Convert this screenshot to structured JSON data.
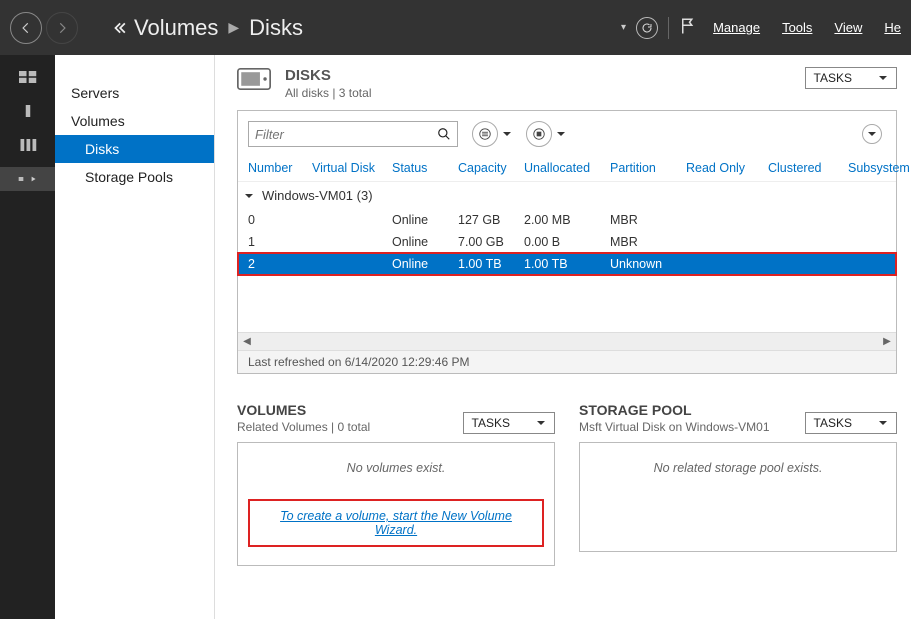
{
  "titlebar": {
    "breadcrumb": [
      "Volumes",
      "Disks"
    ],
    "menu": [
      "Manage",
      "Tools",
      "View",
      "He"
    ]
  },
  "navtree": {
    "items": [
      {
        "label": "Servers",
        "selected": false,
        "child": false
      },
      {
        "label": "Volumes",
        "selected": false,
        "child": false
      },
      {
        "label": "Disks",
        "selected": true,
        "child": true
      },
      {
        "label": "Storage Pools",
        "selected": false,
        "child": true
      }
    ]
  },
  "disks": {
    "title": "DISKS",
    "subtitle": "All disks | 3 total",
    "tasks_label": "TASKS",
    "filter_placeholder": "Filter",
    "columns": [
      "Number",
      "Virtual Disk",
      "Status",
      "Capacity",
      "Unallocated",
      "Partition",
      "Read Only",
      "Clustered",
      "Subsystem"
    ],
    "group": "Windows-VM01 (3)",
    "rows": [
      {
        "number": "0",
        "vdisk": "",
        "status": "Online",
        "capacity": "127 GB",
        "unallocated": "2.00 MB",
        "partition": "MBR",
        "readonly": "",
        "clustered": "",
        "subsystem": "",
        "selected": false
      },
      {
        "number": "1",
        "vdisk": "",
        "status": "Online",
        "capacity": "7.00 GB",
        "unallocated": "0.00 B",
        "partition": "MBR",
        "readonly": "",
        "clustered": "",
        "subsystem": "",
        "selected": false
      },
      {
        "number": "2",
        "vdisk": "",
        "status": "Online",
        "capacity": "1.00 TB",
        "unallocated": "1.00 TB",
        "partition": "Unknown",
        "readonly": "",
        "clustered": "",
        "subsystem": "",
        "selected": true
      }
    ],
    "refreshed": "Last refreshed on 6/14/2020 12:29:46 PM"
  },
  "volumes": {
    "title": "VOLUMES",
    "subtitle": "Related Volumes | 0 total",
    "tasks_label": "TASKS",
    "empty": "No volumes exist.",
    "link": "To create a volume, start the New Volume Wizard."
  },
  "storagepool": {
    "title": "STORAGE POOL",
    "subtitle": "Msft Virtual Disk on Windows-VM01",
    "tasks_label": "TASKS",
    "empty": "No related storage pool exists."
  }
}
